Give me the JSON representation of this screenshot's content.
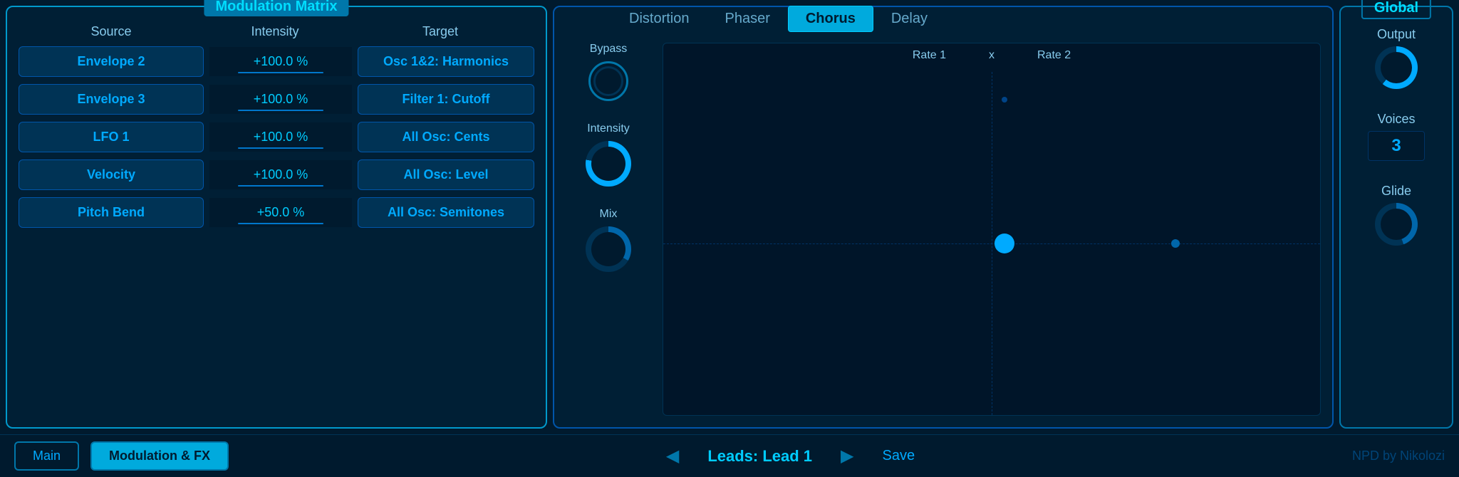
{
  "modulation_matrix": {
    "title": "Modulation Matrix",
    "headers": {
      "source": "Source",
      "intensity": "Intensity",
      "target": "Target"
    },
    "rows": [
      {
        "source": "Envelope 2",
        "intensity": "+100.0 %",
        "target": "Osc 1&2: Harmonics"
      },
      {
        "source": "Envelope 3",
        "intensity": "+100.0 %",
        "target": "Filter 1: Cutoff"
      },
      {
        "source": "LFO 1",
        "intensity": "+100.0 %",
        "target": "All Osc: Cents"
      },
      {
        "source": "Velocity",
        "intensity": "+100.0 %",
        "target": "All Osc: Level"
      },
      {
        "source": "Pitch Bend",
        "intensity": "+50.0 %",
        "target": "All Osc: Semitones"
      }
    ]
  },
  "effects": {
    "tabs": [
      {
        "id": "distortion",
        "label": "Distortion",
        "active": false
      },
      {
        "id": "phaser",
        "label": "Phaser",
        "active": false
      },
      {
        "id": "chorus",
        "label": "Chorus",
        "active": true
      },
      {
        "id": "delay",
        "label": "Delay",
        "active": false
      }
    ],
    "chorus": {
      "bypass_label": "Bypass",
      "intensity_label": "Intensity",
      "mix_label": "Mix",
      "rate1_label": "Rate 1",
      "x_label": "x",
      "rate2_label": "Rate 2"
    }
  },
  "global": {
    "title": "Global",
    "output_label": "Output",
    "voices_label": "Voices",
    "voices_value": "3",
    "glide_label": "Glide"
  },
  "bottom_bar": {
    "main_tab": "Main",
    "mod_fx_tab": "Modulation & FX",
    "preset_name": "Leads: Lead 1",
    "save_label": "Save",
    "brand": "NPD by Nikolozi"
  }
}
